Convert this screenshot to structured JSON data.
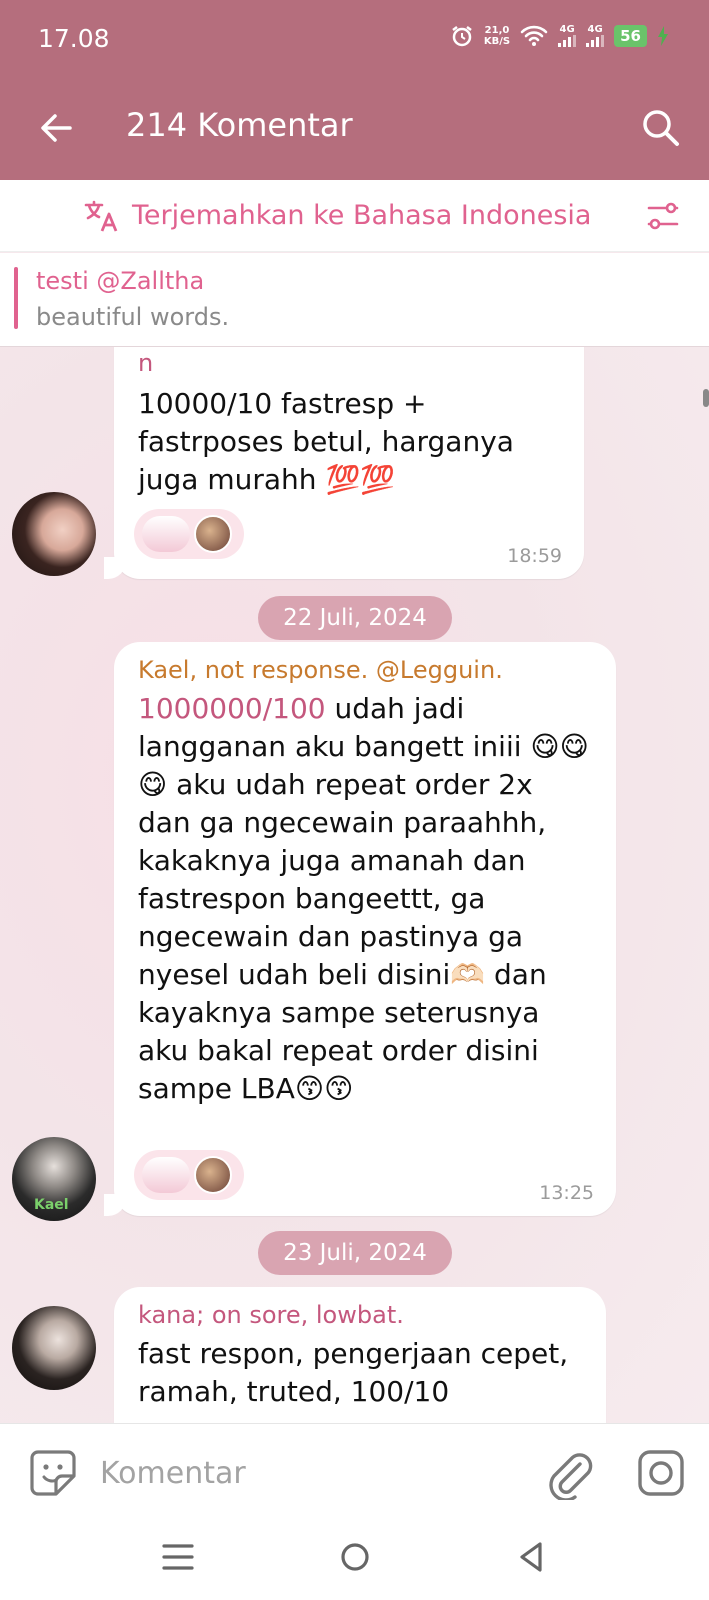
{
  "status_bar": {
    "time": "17.08",
    "net_speed_value": "21,0",
    "net_speed_unit": "KB/S",
    "signal1": "4G",
    "signal2": "4G",
    "battery": "56"
  },
  "app_bar": {
    "title": "214 Komentar"
  },
  "translate": {
    "label": "Terjemahkan ke Bahasa Indonesia"
  },
  "pinned": {
    "title": "testi @Zalltha",
    "text": "beautiful words."
  },
  "messages": [
    {
      "sender": "n",
      "text": "10000/10 fastresp + fastrposes betul, harganya juga murahh 💯💯",
      "time": "18:59"
    },
    {
      "sender": "Kael, not response. @Legguin.",
      "highlight": "1000000/100",
      "text": "udah jadi langganan aku bangett iniii 😋😋😋 aku udah repeat order 2x dan ga ngecewain paraahhh, kakaknya juga amanah dan fastrespon bangeettt, ga ngecewain dan pastinya ga nyesel udah beli disini🫶🏻 dan kayaknya sampe seterusnya aku bakal repeat order disini sampe LBA😙😙",
      "time": "13:25",
      "avatar_label": "Kael"
    },
    {
      "sender": "kana; on sore, lowbat.",
      "text": "fast respon, pengerjaan cepet, ramah, truted, 100/10"
    }
  ],
  "dates": [
    "22 Juli, 2024",
    "23 Juli, 2024"
  ],
  "composer": {
    "placeholder": "Komentar"
  },
  "colors": {
    "header": "#b56e7d",
    "accent": "#e0628f",
    "date_pill": "#d9a4b1",
    "sender_orange": "#c77a2e",
    "sender_pink": "#c4577d"
  }
}
